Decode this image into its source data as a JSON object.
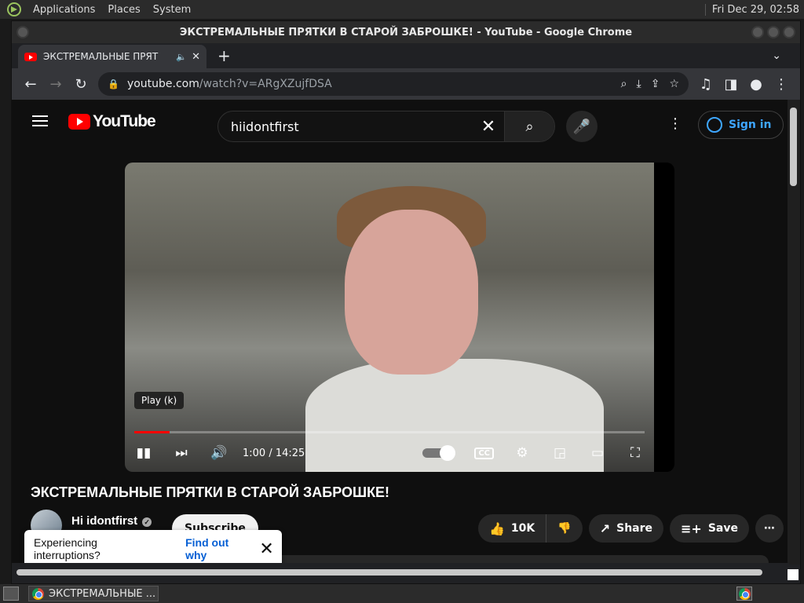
{
  "desktop": {
    "menus": [
      "Applications",
      "Places",
      "System"
    ],
    "clock": "Fri Dec 29, 02:58"
  },
  "window": {
    "title": "ЭКСТРЕМАЛЬНЫЕ ПРЯТКИ В СТАРОЙ ЗАБРОШКЕ! - YouTube - Google Chrome"
  },
  "tab": {
    "title": "ЭКСТРЕМАЛЬНЫЕ ПРЯТ",
    "new_tab": "+"
  },
  "omnibox": {
    "host": "youtube.com",
    "path": "/watch?v=ARgXZujfDSA"
  },
  "youtube": {
    "logo_text": "YouTube",
    "search_value": "hiidontfirst",
    "signin_label": "Sign in"
  },
  "player": {
    "tooltip": "Play (k)",
    "time_current": "1:00",
    "time_total": "14:25",
    "progress_fraction": 0.0694,
    "cc_label": "CC"
  },
  "video": {
    "title": "ЭКСТРЕМАЛЬНЫЕ ПРЯТКИ В СТАРОЙ ЗАБРОШКЕ!",
    "channel": "Hi idontfirst",
    "subscribe_label": "Subscribe",
    "likes": "10K",
    "share_label": "Share",
    "save_label": "Save"
  },
  "toast": {
    "message": "Experiencing interruptions?",
    "link": "Find out why"
  },
  "taskbar": {
    "task_label": "ЭКСТРЕМАЛЬНЫЕ ..."
  },
  "colors": {
    "yt_red": "#ff0000",
    "link_blue": "#3ea6ff",
    "page_bg": "#0f0f0f"
  }
}
